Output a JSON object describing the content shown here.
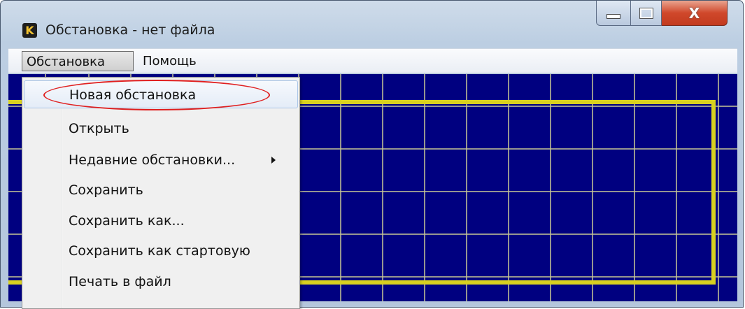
{
  "window": {
    "app_icon_letter": "K",
    "title": "Обстановка - нет файла",
    "controls": {
      "minimize": "minimize-icon",
      "maximize": "maximize-icon",
      "close": "close-icon",
      "close_glyph": "X"
    }
  },
  "menubar": {
    "items": [
      {
        "label": "Обстановка",
        "active": true
      },
      {
        "label": "Помощь",
        "active": false
      }
    ]
  },
  "dropdown": {
    "items": [
      {
        "label": "Новая обстановка",
        "highlighted": true
      },
      {
        "label": "Открыть"
      },
      {
        "label": "Недавние обстановки...",
        "has_submenu": true
      },
      {
        "label": "Сохранить"
      },
      {
        "label": "Сохранить как..."
      },
      {
        "label": "Сохранить как стартовую"
      },
      {
        "label": "Печать в файл"
      }
    ]
  },
  "colors": {
    "canvas_background": "#000080",
    "grid_lines": "#c8c896",
    "border_frame": "#d8d020",
    "annotation_ellipse": "#e02020"
  }
}
